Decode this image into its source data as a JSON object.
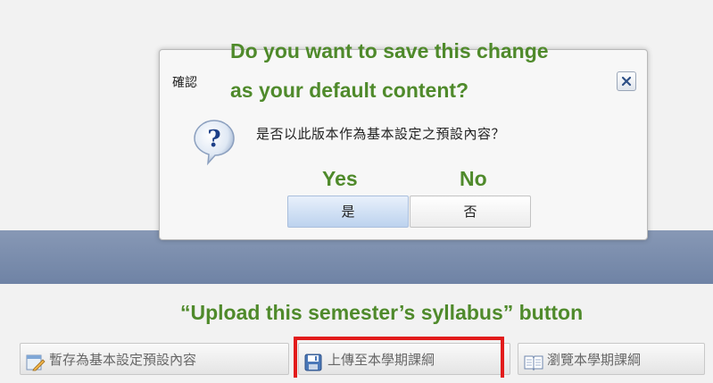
{
  "dialog": {
    "title": "確認",
    "message": "是否以此版本作為基本設定之預設內容？",
    "yes_label": "是",
    "no_label": "否",
    "close_icon": "close-icon",
    "question_icon": "question-icon"
  },
  "annotations": {
    "question_line1": "Do you want to save this change",
    "question_line2": "as your default content?",
    "yes": "Yes",
    "no": "No",
    "upload_caption": "“Upload this semester’s syllabus” button"
  },
  "toolbar": {
    "draft_label": "暫存為基本設定預設內容",
    "upload_label": "上傳至本學期課綱",
    "browse_label": "瀏覽本學期課綱"
  },
  "colors": {
    "annotation_green": "#4f8a2b",
    "highlight_red": "#e21b1b",
    "blue_bar": "#7a8dad"
  }
}
